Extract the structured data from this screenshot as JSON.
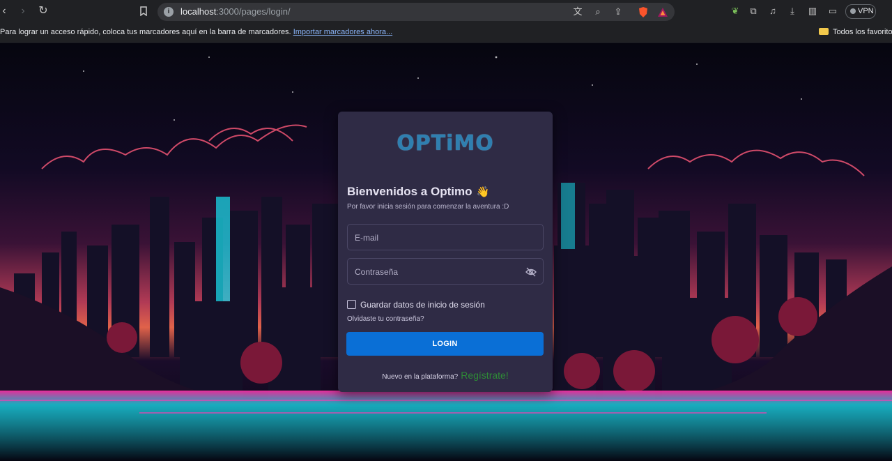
{
  "browser": {
    "url_host": "localhost",
    "url_path": ":3000/pages/login/",
    "vpn_label": "VPN",
    "bookmarks_prompt": "Para lograr un acceso rápido, coloca tus marcadores aquí en la barra de marcadores.",
    "import_link": "Importar marcadores ahora...",
    "favorites_folder": "Todos los favoritos",
    "icons": [
      "back-icon",
      "forward-icon",
      "reload-icon",
      "bookmark-icon",
      "info-icon",
      "translate-icon",
      "zoom-icon",
      "share-icon",
      "brave-shield-icon",
      "brave-rewards-icon",
      "leaf-extension-icon",
      "extensions-icon",
      "music-icon",
      "download-icon",
      "sidebar-icon",
      "wallet-icon"
    ]
  },
  "login": {
    "logo": "OPTiMO",
    "welcome": "Bienvenidos a Optimo",
    "wave_emoji": "👋",
    "subtitle": "Por favor inicia sesión para comenzar la aventura :D",
    "email_placeholder": "E-mail",
    "password_placeholder": "Contraseña",
    "remember_label": "Guardar datos de inicio de sesión",
    "forgot_link": "Olvidaste tu contraseña?",
    "login_button": "LOGIN",
    "register_question": "Nuevo en la plataforma?",
    "register_link": "Regístrate!"
  },
  "colors": {
    "card_bg": "#2f2b45",
    "button_bg": "#0a6fd6",
    "logo": "#2f7fb0",
    "register_link": "#2e8b36"
  }
}
